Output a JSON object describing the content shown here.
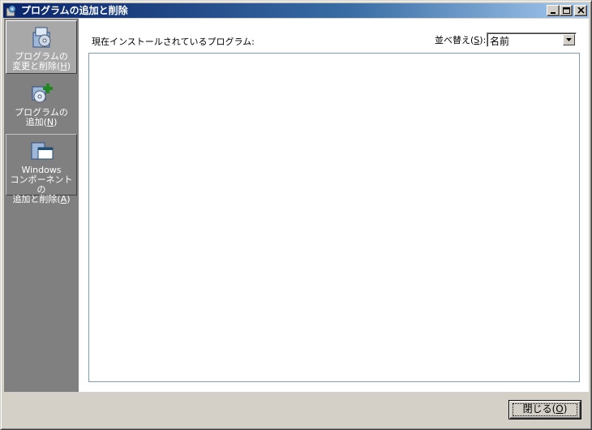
{
  "window": {
    "title": "プログラムの追加と削除",
    "controls": {
      "minimize": "minimize-icon",
      "maximize": "maximize-icon",
      "close": "close-icon"
    }
  },
  "sidebar": {
    "items": [
      {
        "label_1": "プログラムの",
        "label_2a": "変更と削除(",
        "key": "H",
        "label_2b": ")",
        "icon": "change-remove-programs-icon",
        "active": true
      },
      {
        "label_1": "プログラムの",
        "label_2a": "追加(",
        "key": "N",
        "label_2b": ")",
        "icon": "add-programs-icon",
        "active": false
      },
      {
        "label_1": "Windows",
        "label_2": "コンポーネントの",
        "label_3a": "追加と削除(",
        "key": "A",
        "label_3b": ")",
        "icon": "windows-components-icon",
        "active": false
      }
    ]
  },
  "main": {
    "current_label": "現在インストールされているプログラム:",
    "sort": {
      "label_a": "並べ替え(",
      "key": "S",
      "label_b": "):",
      "value": "名前"
    }
  },
  "footer": {
    "close_a": "閉じる(",
    "close_key": "O",
    "close_b": ")"
  },
  "colors": {
    "titlebar_start": "#0a246a",
    "sidebar_bg": "#808080",
    "face": "#d4d0c8"
  }
}
